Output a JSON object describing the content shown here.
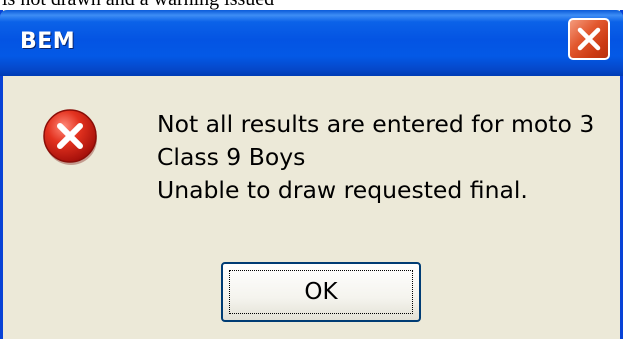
{
  "background_caption": "is not drawn and a warning issued",
  "dialog": {
    "title": "BEM",
    "close_icon": "close-icon",
    "status_icon": "error-icon",
    "message_lines": [
      "Not all results are entered for moto 3",
      "Class 9 Boys",
      "Unable to draw requested final."
    ],
    "ok_label": "OK"
  },
  "colors": {
    "titlebar": "#0454e3",
    "dialog_background": "#ece9d8",
    "close_button": "#e2582f",
    "error_icon": "#d3231b"
  }
}
